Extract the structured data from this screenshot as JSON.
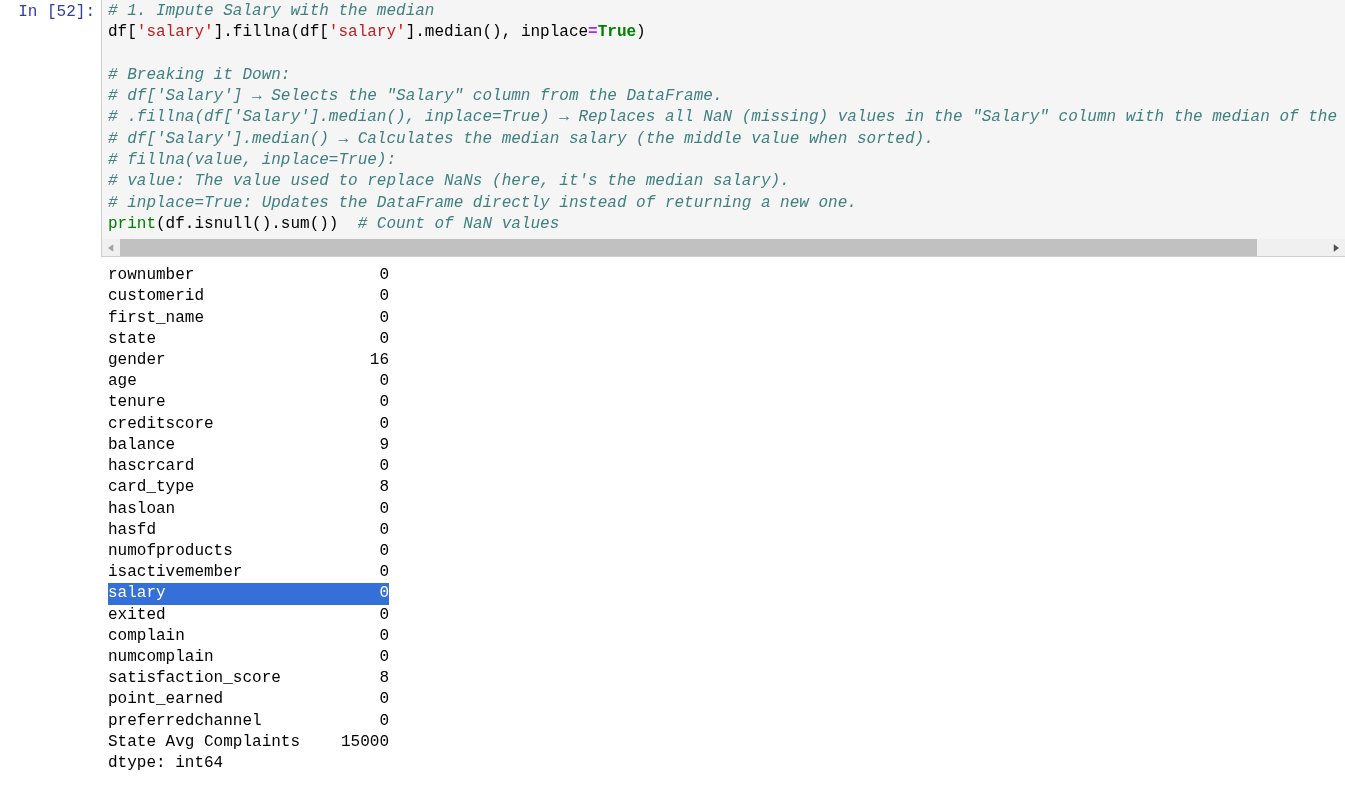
{
  "cell": {
    "prompt": "In [52]:",
    "code_lines": [
      [
        {
          "kind": "comment",
          "text": "# 1. Impute Salary with the median"
        }
      ],
      [
        {
          "kind": "plain",
          "text": "df["
        },
        {
          "kind": "string",
          "text": "'salary'"
        },
        {
          "kind": "plain",
          "text": "].fillna(df["
        },
        {
          "kind": "string",
          "text": "'salary'"
        },
        {
          "kind": "plain",
          "text": "].median(), inplace"
        },
        {
          "kind": "operator",
          "text": "="
        },
        {
          "kind": "keyword",
          "text": "True"
        },
        {
          "kind": "plain",
          "text": ")"
        }
      ],
      [
        {
          "kind": "blank"
        }
      ],
      [
        {
          "kind": "comment",
          "text": "# Breaking it Down:"
        }
      ],
      [
        {
          "kind": "comment",
          "text": "# df['Salary'] → Selects the \"Salary\" column from the DataFrame."
        }
      ],
      [
        {
          "kind": "comment",
          "text": "# .fillna(df['Salary'].median(), inplace=True) → Replaces all NaN (missing) values in the \"Salary\" column with the median of the"
        }
      ],
      [
        {
          "kind": "comment",
          "text": "# df['Salary'].median() → Calculates the median salary (the middle value when sorted)."
        }
      ],
      [
        {
          "kind": "comment",
          "text": "# fillna(value, inplace=True):"
        }
      ],
      [
        {
          "kind": "comment",
          "text": "# value: The value used to replace NaNs (here, it's the median salary)."
        }
      ],
      [
        {
          "kind": "comment",
          "text": "# inplace=True: Updates the DataFrame directly instead of returning a new one."
        }
      ],
      [
        {
          "kind": "builtin",
          "text": "print"
        },
        {
          "kind": "plain",
          "text": "(df.isnull().sum())  "
        },
        {
          "kind": "comment",
          "text": "# Count of NaN values"
        }
      ]
    ]
  },
  "output": {
    "rows": [
      {
        "name": "rownumber",
        "value": "0",
        "selected": false
      },
      {
        "name": "customerid",
        "value": "0",
        "selected": false
      },
      {
        "name": "first_name",
        "value": "0",
        "selected": false
      },
      {
        "name": "state",
        "value": "0",
        "selected": false
      },
      {
        "name": "gender",
        "value": "16",
        "selected": false
      },
      {
        "name": "age",
        "value": "0",
        "selected": false
      },
      {
        "name": "tenure",
        "value": "0",
        "selected": false
      },
      {
        "name": "creditscore",
        "value": "0",
        "selected": false
      },
      {
        "name": "balance",
        "value": "9",
        "selected": false
      },
      {
        "name": "hascrcard",
        "value": "0",
        "selected": false
      },
      {
        "name": "card_type",
        "value": "8",
        "selected": false
      },
      {
        "name": "hasloan",
        "value": "0",
        "selected": false
      },
      {
        "name": "hasfd",
        "value": "0",
        "selected": false
      },
      {
        "name": "numofproducts",
        "value": "0",
        "selected": false
      },
      {
        "name": "isactivemember",
        "value": "0",
        "selected": false
      },
      {
        "name": "salary",
        "value": "0",
        "selected": true
      },
      {
        "name": "exited",
        "value": "0",
        "selected": false
      },
      {
        "name": "complain",
        "value": "0",
        "selected": false
      },
      {
        "name": "numcomplain",
        "value": "0",
        "selected": false
      },
      {
        "name": "satisfaction_score",
        "value": "8",
        "selected": false
      },
      {
        "name": "point_earned",
        "value": "0",
        "selected": false
      },
      {
        "name": "preferredchannel",
        "value": "0",
        "selected": false
      },
      {
        "name": "State Avg Complaints",
        "value": "15000",
        "selected": false
      }
    ],
    "dtype": "dtype: int64"
  }
}
